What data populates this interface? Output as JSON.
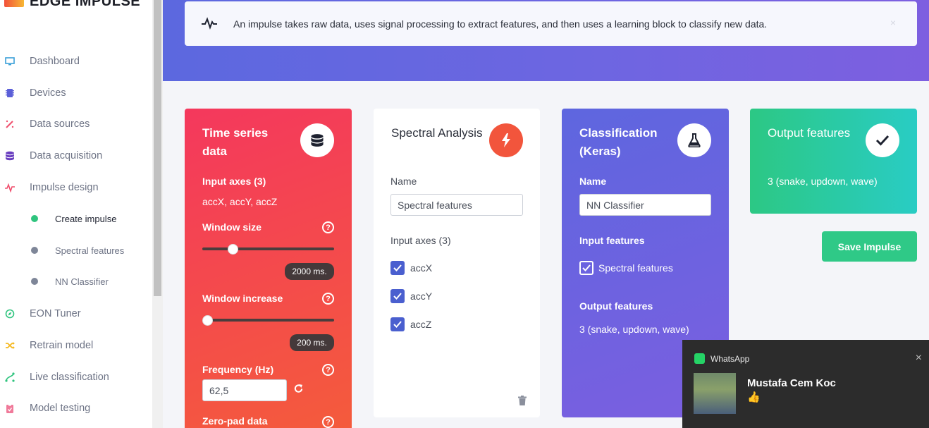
{
  "app": {
    "name": "EDGE IMPULSE"
  },
  "sidebar": {
    "items": [
      {
        "label": "Dashboard",
        "icon": "monitor-icon",
        "color": "#3aa0d8"
      },
      {
        "label": "Devices",
        "icon": "chip-icon",
        "color": "#5b5fd8"
      },
      {
        "label": "Data sources",
        "icon": "wand-icon",
        "color": "#f0506e"
      },
      {
        "label": "Data acquisition",
        "icon": "database-icon",
        "color": "#6a3fc0"
      },
      {
        "label": "Impulse design",
        "icon": "pulse-icon",
        "color": "#f0506e"
      },
      {
        "label": "EON Tuner",
        "icon": "compass-icon",
        "color": "#2fc47e"
      },
      {
        "label": "Retrain model",
        "icon": "shuffle-icon",
        "color": "#f5b922"
      },
      {
        "label": "Live classification",
        "icon": "flow-icon",
        "color": "#2fc47e"
      },
      {
        "label": "Model testing",
        "icon": "clipboard-icon",
        "color": "#f07a9a"
      }
    ],
    "subitems": [
      {
        "label": "Create impulse",
        "active": true
      },
      {
        "label": "Spectral features",
        "active": false
      },
      {
        "label": "NN Classifier",
        "active": false
      }
    ]
  },
  "banner": {
    "info_text": "An impulse takes raw data, uses signal processing to extract features, and then uses a learning block to classify new data.",
    "close": "×"
  },
  "time_series": {
    "title": "Time series data",
    "input_axes_label": "Input axes (3)",
    "input_axes_value": "accX, accY, accZ",
    "window_size_label": "Window size",
    "window_size_value": "2000 ms.",
    "window_size_fraction": 0.21,
    "window_increase_label": "Window increase",
    "window_increase_value": "200 ms.",
    "window_increase_fraction": 0.0,
    "frequency_label": "Frequency (Hz)",
    "frequency_value": "62,5",
    "zero_pad_label": "Zero-pad data",
    "help": "?"
  },
  "spectral": {
    "title": "Spectral Analysis",
    "name_label": "Name",
    "name_value": "Spectral features",
    "input_axes_label": "Input axes (3)",
    "axes": [
      "accX",
      "accY",
      "accZ"
    ]
  },
  "classification": {
    "title": "Classification (Keras)",
    "name_label": "Name",
    "name_value": "NN Classifier",
    "input_features_label": "Input features",
    "input_feature": "Spectral features",
    "output_features_label": "Output features",
    "output_features_value": "3 (snake, updown, wave)"
  },
  "output": {
    "title": "Output features",
    "value": "3 (snake, updown, wave)"
  },
  "save_button": "Save Impulse",
  "toast": {
    "app": "WhatsApp",
    "sender": "Mustafa Cem Koc",
    "message": "👍",
    "close": "×"
  }
}
